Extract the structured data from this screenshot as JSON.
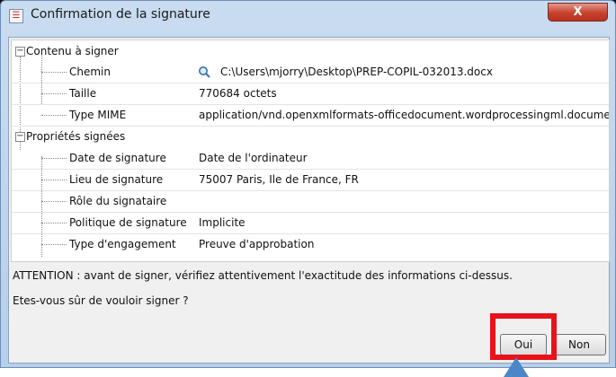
{
  "window": {
    "title": "Confirmation de la signature",
    "close_label": "X"
  },
  "tree": {
    "groups": [
      {
        "label": "Contenu à signer",
        "items": [
          {
            "label": "Chemin",
            "value": "C:\\Users\\mjorry\\Desktop\\PREP-COPIL-032013.docx",
            "icon": "magnifier-icon"
          },
          {
            "label": "Taille",
            "value": "770684 octets"
          },
          {
            "label": "Type MIME",
            "value": "application/vnd.openxmlformats-officedocument.wordprocessingml.document"
          }
        ]
      },
      {
        "label": "Propriétés signées",
        "items": [
          {
            "label": "Date de signature",
            "value": "Date de l'ordinateur"
          },
          {
            "label": "Lieu de signature",
            "value": "75007 Paris, Ile de France, FR"
          },
          {
            "label": "Rôle du signataire",
            "value": ""
          },
          {
            "label": "Politique de signature",
            "value": "Implicite"
          },
          {
            "label": "Type d'engagement",
            "value": "Preuve d'approbation"
          }
        ]
      }
    ]
  },
  "messages": {
    "warning": "ATTENTION : avant de signer, vérifiez attentivement l'exactitude des informations ci-dessus.",
    "question": "Etes-vous sûr de vouloir signer ?"
  },
  "buttons": {
    "yes": "Oui",
    "no": "Non"
  },
  "colors": {
    "highlight": "#e8121a",
    "pointer": "#4a86c8"
  }
}
